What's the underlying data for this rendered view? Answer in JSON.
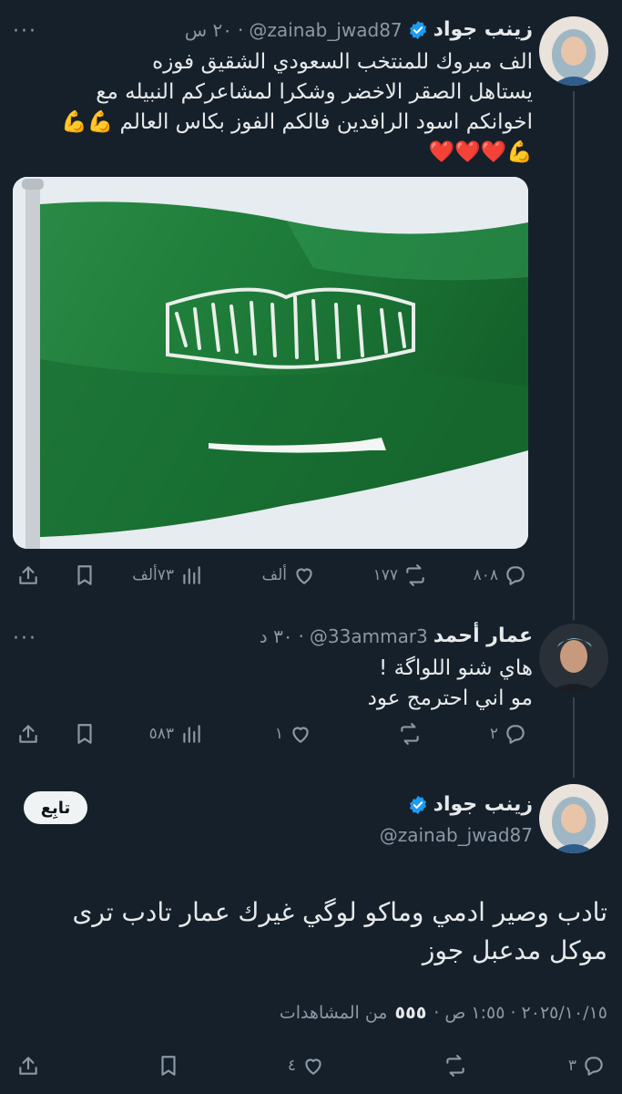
{
  "tweet1": {
    "name": "زينب جواد",
    "handle": "@zainab_jwad87",
    "time": "٢٠ س",
    "text_lines": [
      "الف مبروك للمنتخب السعودي الشقيق فوزه",
      "يستاهل الصقر الاخضر وشكرا لمشاعركم النبيله مع",
      "اخوانكم اسود الرافدين فالكم الفوز بكاس العالم 💪💪",
      "💪❤️❤️❤️"
    ],
    "more_label": "···",
    "stats": {
      "replies": "٨٠٨",
      "reposts": "١٧٧",
      "likes": "ألف",
      "views": "٧٣ألف"
    }
  },
  "tweet2": {
    "name": "عمار أحمد",
    "handle": "@33ammar3",
    "time": "٣٠ د",
    "separator": "·",
    "text_lines": [
      "هاي شنو اللواگة !",
      "مو اني احترمج عود"
    ],
    "more_label": "···",
    "stats": {
      "replies": "٢",
      "reposts": "",
      "likes": "١",
      "views": "٥٨٣"
    }
  },
  "main_tweet": {
    "name": "زينب جواد",
    "handle": "@zainab_jwad87",
    "follow_label": "تابِع",
    "text": "تادب وصير ادمي وماكو لوگي غيرك عمار تادب ترى موكل مدعبل جوز",
    "timestamp_line": "٢٠٢٥/١٠/١٥ · ١:٥٥ ص ·",
    "views_count": "٥٥٥",
    "views_label": "من المشاهدات",
    "stats": {
      "replies": "٣",
      "likes": "٤"
    }
  },
  "colors": {
    "background": "#15202b",
    "verified": "#1d9bf0",
    "flag_green": "#1f7a3a",
    "muted": "#8b98a5"
  },
  "icons": [
    "reply-icon",
    "repost-icon",
    "like-icon",
    "views-icon",
    "bookmark-icon",
    "share-icon",
    "verified-icon",
    "more-icon"
  ]
}
